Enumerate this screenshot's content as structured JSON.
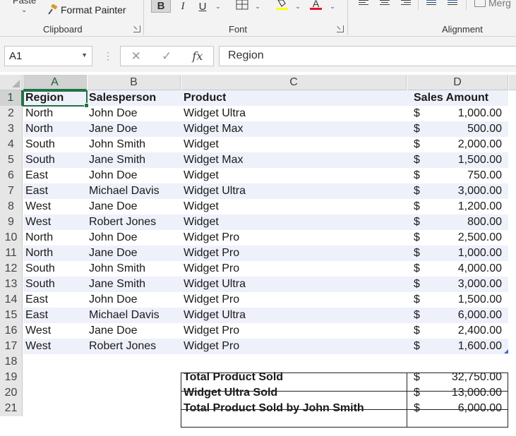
{
  "ribbon": {
    "paste_label": "Paste",
    "format_painter_label": "Format Painter",
    "groups": {
      "clipboard": "Clipboard",
      "font": "Font",
      "alignment": "Alignment"
    },
    "bold_label": "B",
    "italic_label": "I",
    "underline_label": "U",
    "merge_label": "Merg",
    "font_color_letter": "A",
    "colors": {
      "font_color": "#e81123",
      "highlight": "#ffff00",
      "accent": "#217346"
    }
  },
  "formula_bar": {
    "name_box": "A1",
    "cancel_glyph": "✕",
    "enter_glyph": "✓",
    "fx_label": "fx",
    "formula": "Region"
  },
  "sheet": {
    "columns": [
      "A",
      "B",
      "C",
      "D"
    ],
    "rows": [
      "1",
      "2",
      "3",
      "4",
      "5",
      "6",
      "7",
      "8",
      "9",
      "10",
      "11",
      "12",
      "13",
      "14",
      "15",
      "16",
      "17",
      "18",
      "19",
      "20",
      "21"
    ],
    "headers": {
      "region": "Region",
      "salesperson": "Salesperson",
      "product": "Product",
      "amount": "Sales Amount"
    },
    "currency": "$",
    "data": [
      {
        "region": "North",
        "salesperson": "John Doe",
        "product": "Widget Ultra",
        "amount": "1,000.00"
      },
      {
        "region": "North",
        "salesperson": "Jane Doe",
        "product": "Widget Max",
        "amount": "500.00"
      },
      {
        "region": "South",
        "salesperson": "John Smith",
        "product": "Widget",
        "amount": "2,000.00"
      },
      {
        "region": "South",
        "salesperson": "Jane Smith",
        "product": "Widget Max",
        "amount": "1,500.00"
      },
      {
        "region": "East",
        "salesperson": "John Doe",
        "product": "Widget",
        "amount": "750.00"
      },
      {
        "region": "East",
        "salesperson": "Michael Davis",
        "product": "Widget Ultra",
        "amount": "3,000.00"
      },
      {
        "region": "West",
        "salesperson": "Jane Doe",
        "product": "Widget",
        "amount": "1,200.00"
      },
      {
        "region": "West",
        "salesperson": "Robert Jones",
        "product": "Widget",
        "amount": "800.00"
      },
      {
        "region": "North",
        "salesperson": "John Doe",
        "product": "Widget Pro",
        "amount": "2,500.00"
      },
      {
        "region": "North",
        "salesperson": "Jane Doe",
        "product": "Widget Pro",
        "amount": "1,000.00"
      },
      {
        "region": "South",
        "salesperson": "John Smith",
        "product": "Widget Pro",
        "amount": "4,000.00"
      },
      {
        "region": "South",
        "salesperson": "Jane Smith",
        "product": "Widget Ultra",
        "amount": "3,000.00"
      },
      {
        "region": "East",
        "salesperson": "John Doe",
        "product": "Widget Pro",
        "amount": "1,500.00"
      },
      {
        "region": "East",
        "salesperson": "Michael Davis",
        "product": "Widget Ultra",
        "amount": "6,000.00"
      },
      {
        "region": "West",
        "salesperson": "Jane Doe",
        "product": "Widget Pro",
        "amount": "2,400.00"
      },
      {
        "region": "West",
        "salesperson": "Robert Jones",
        "product": "Widget Pro",
        "amount": "1,600.00"
      }
    ],
    "summary": [
      {
        "label": "Total Product Sold",
        "amount": "32,750.00"
      },
      {
        "label": "Widget Ultra Sold",
        "amount": "13,000.00"
      },
      {
        "label": "Total Product Sold by John Smith",
        "amount": "6,000.00"
      }
    ]
  }
}
